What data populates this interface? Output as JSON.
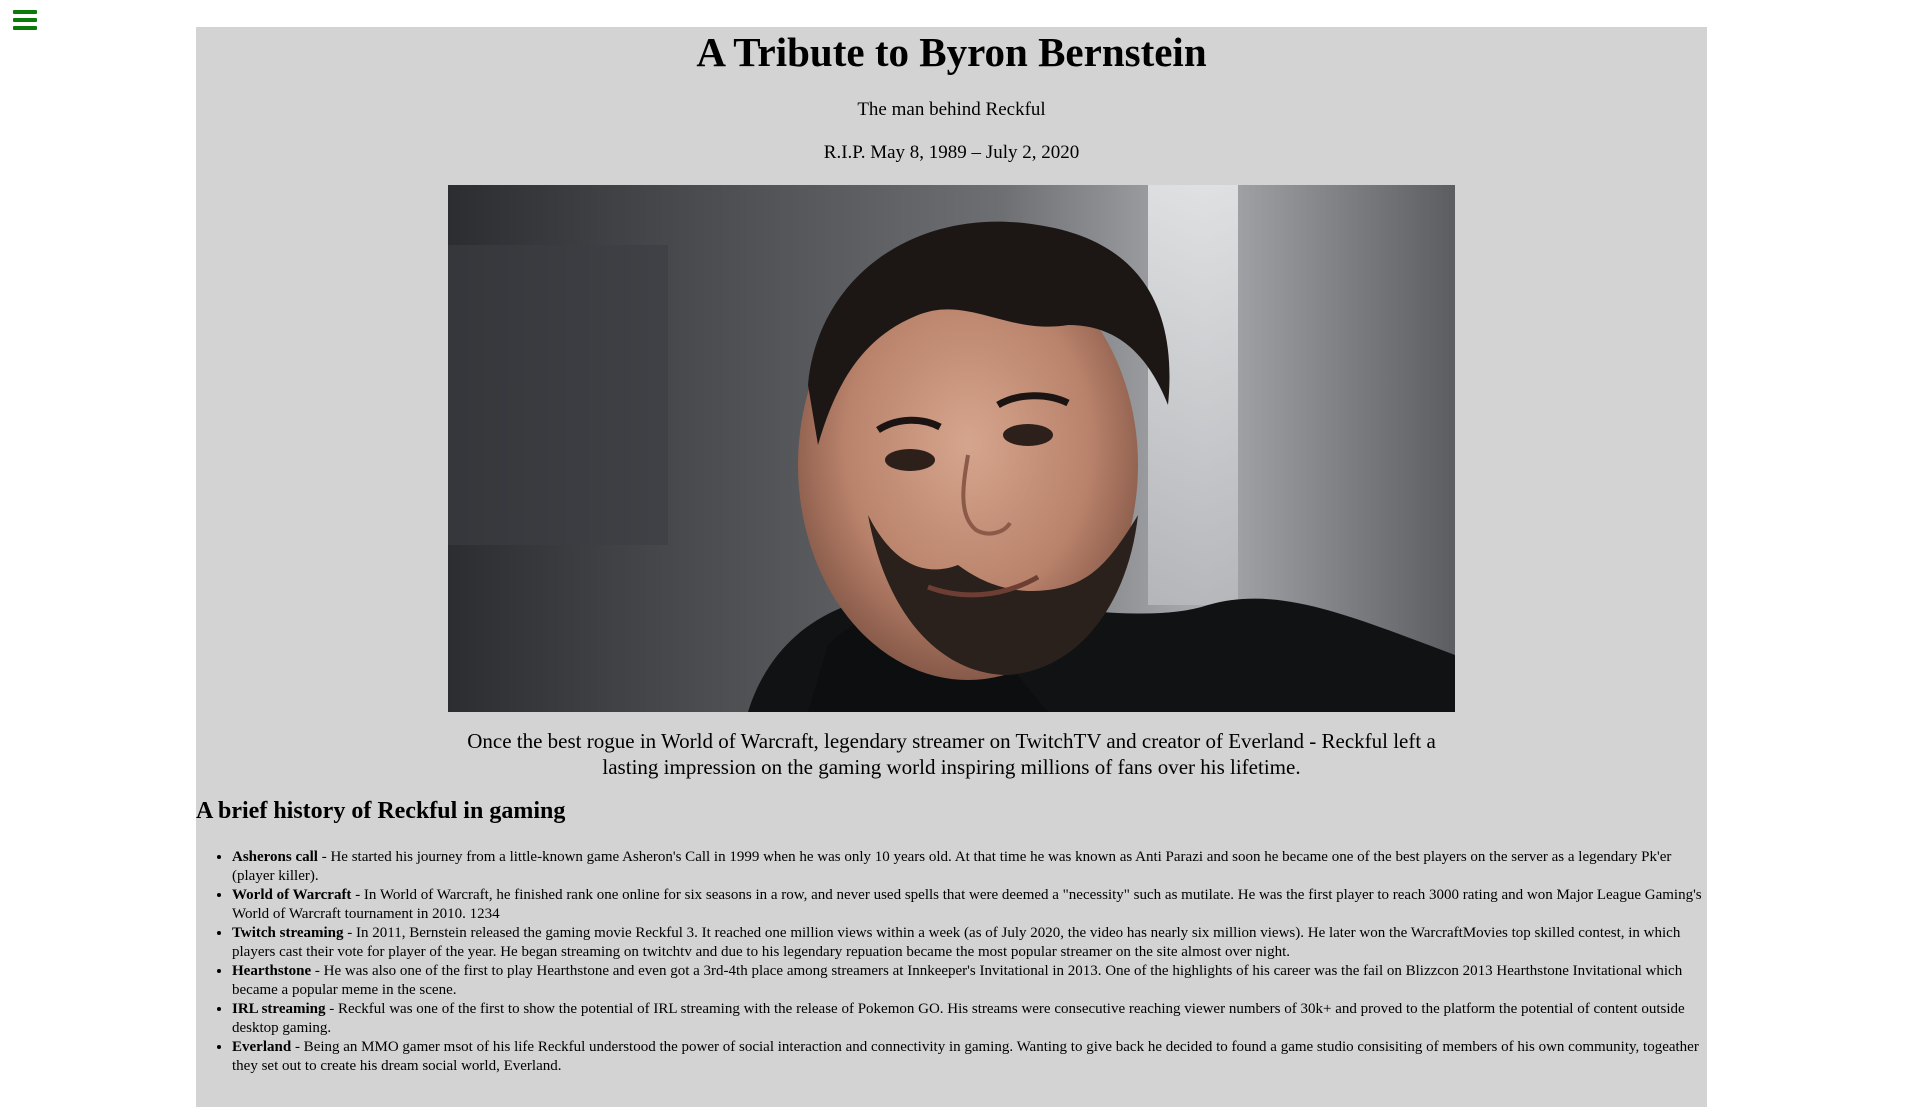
{
  "page": {
    "title": "A Tribute to Byron Bernstein",
    "subtitle": "The man behind Reckful",
    "dates": "R.I.P. May 8, 1989 – July 2, 2020",
    "caption": "Once the best rogue in World of Warcraft, legendary streamer on TwitchTV and creator of Everland - Reckful left a lasting impression on the gaming world inspiring millions of fans over his lifetime."
  },
  "history": {
    "heading": "A brief history of Reckful in gaming",
    "items": [
      {
        "name": "Asherons call",
        "text": " - He started his journey from a little-known game Asheron's Call in 1999 when he was only 10 years old. At that time he was known as Anti Parazi and soon he became one of the best players on the server as a legendary Pk'er (player killer)."
      },
      {
        "name": "World of Warcraft",
        "text": " - In World of Warcraft, he finished rank one online for six seasons in a row, and never used spells that were deemed a \"necessity\" such as mutilate. He was the first player to reach 3000 rating and won Major League Gaming's World of Warcraft tournament in 2010. 1234"
      },
      {
        "name": "Twitch streaming",
        "text": " - In 2011, Bernstein released the gaming movie Reckful 3. It reached one million views within a week (as of July 2020, the video has nearly six million views). He later won the WarcraftMovies top skilled contest, in which players cast their vote for player of the year. He began streaming on twitchtv and due to his legendary repuation became the most popular streamer on the site almost over night."
      },
      {
        "name": "Hearthstone",
        "text": " - He was also one of the first to play Hearthstone and even got a 3rd-4th place among streamers at Innkeeper's Invitational in 2013. One of the highlights of his career was the fail on Blizzcon 2013 Hearthstone Invitational which became a popular meme in the scene."
      },
      {
        "name": "IRL streaming",
        "text": " - Reckful was one of the first to show the potential of IRL streaming with the release of Pokemon GO. His streams were consecutive reaching viewer numbers of 30k+ and proved to the platform the potential of content outside desktop gaming."
      },
      {
        "name": "Everland",
        "text": " - Being an MMO gamer msot of his life Reckful understood the power of social interaction and connectivity in gaming. Wanting to give back he decided to found a game studio consisiting of members of his own community, togeather they set out to create his dream social world, Everland."
      }
    ]
  },
  "colors": {
    "background": "#ffffff",
    "panel": "#d3d3d3",
    "menu_icon": "#0a7a0a"
  },
  "icons": {
    "menu": "hamburger-menu-icon"
  }
}
